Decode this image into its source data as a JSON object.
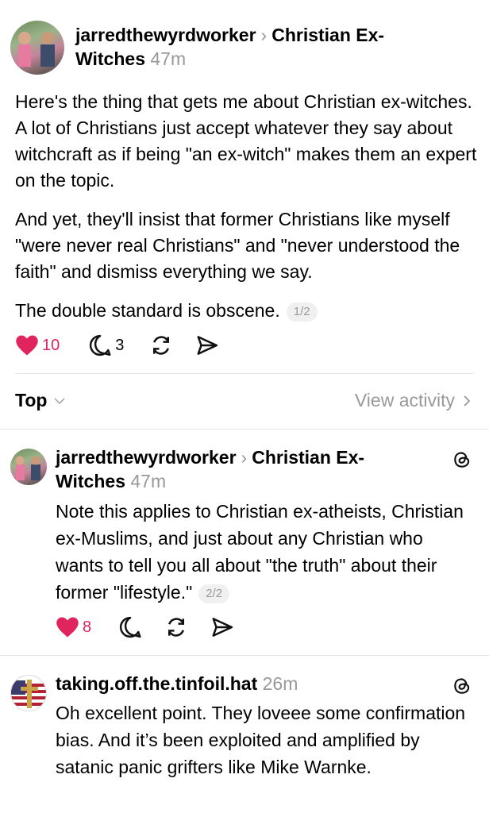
{
  "main_post": {
    "author": "jarredthewyrdworker",
    "community": "Christian Ex-Witches",
    "community_line1": "Christian Ex-",
    "community_line2": "Witches",
    "time": "47m",
    "paragraphs": [
      "Here's the thing that gets me about Christian ex-witches. A lot of Christians just accept whatever they say about witchcraft as if being \"an ex-witch\" makes them an expert on the topic.",
      "And yet, they'll insist that former Christians like myself \"were never real Christians\" and \"never understood the faith\" and dismiss everything we say.",
      "The double standard is obscene."
    ],
    "page_indicator": "1/2",
    "likes": "10",
    "replies": "3",
    "like_color": "#e0245e"
  },
  "sort_bar": {
    "label": "Top",
    "view_activity": "View activity"
  },
  "reply1": {
    "author": "jarredthewyrdworker",
    "community_line1": "Christian Ex-",
    "community_line2": "Witches",
    "time": "47m",
    "text": "Note this applies to Christian ex-atheists, Christian ex-Muslims, and just about any Christian who wants to tell you all about \"the truth\" about their former \"lifestyle.\"",
    "page_indicator": "2/2",
    "likes": "8"
  },
  "reply2": {
    "author": "taking.off.the.tinfoil.hat",
    "time": "26m",
    "text": "Oh excellent point. They loveee some confirmation bias. And it’s been exploited and amplified by satanic panic grifters like Mike Warnke."
  },
  "icons": {
    "heart": "heart-icon",
    "reply": "reply-icon",
    "repost": "repost-icon",
    "share": "share-icon",
    "threads": "threads-icon",
    "chevron_down": "chevron-down-icon",
    "chevron_right": "chevron-right-icon"
  }
}
